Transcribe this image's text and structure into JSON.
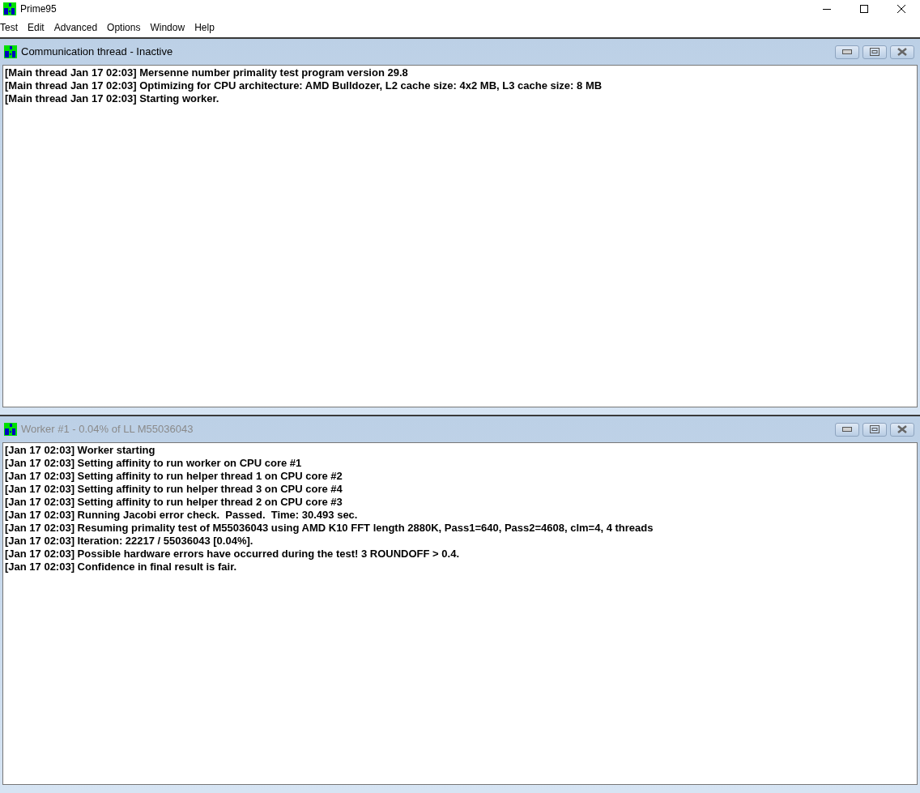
{
  "window": {
    "title": "Prime95"
  },
  "menu": [
    "Test",
    "Edit",
    "Advanced",
    "Options",
    "Window",
    "Help"
  ],
  "child_windows": [
    {
      "title": "Communication thread - Inactive",
      "active": true,
      "lines": [
        "[Main thread Jan 17 02:03] Mersenne number primality test program version 29.8",
        "[Main thread Jan 17 02:03] Optimizing for CPU architecture: AMD Bulldozer, L2 cache size: 4x2 MB, L3 cache size: 8 MB",
        "[Main thread Jan 17 02:03] Starting worker."
      ]
    },
    {
      "title": "Worker #1 - 0.04% of LL M55036043",
      "active": false,
      "lines": [
        "[Jan 17 02:03] Worker starting",
        "[Jan 17 02:03] Setting affinity to run worker on CPU core #1",
        "[Jan 17 02:03] Setting affinity to run helper thread 1 on CPU core #2",
        "[Jan 17 02:03] Setting affinity to run helper thread 3 on CPU core #4",
        "[Jan 17 02:03] Setting affinity to run helper thread 2 on CPU core #3",
        "[Jan 17 02:03] Running Jacobi error check.  Passed.  Time: 30.493 sec.",
        "[Jan 17 02:03] Resuming primality test of M55036043 using AMD K10 FFT length 2880K, Pass1=640, Pass2=4608, clm=4, 4 threads",
        "[Jan 17 02:03] Iteration: 22217 / 55036043 [0.04%].",
        "[Jan 17 02:03] Possible hardware errors have occurred during the test! 3 ROUNDOFF > 0.4.",
        "[Jan 17 02:03] Confidence in final result is fair."
      ]
    }
  ]
}
